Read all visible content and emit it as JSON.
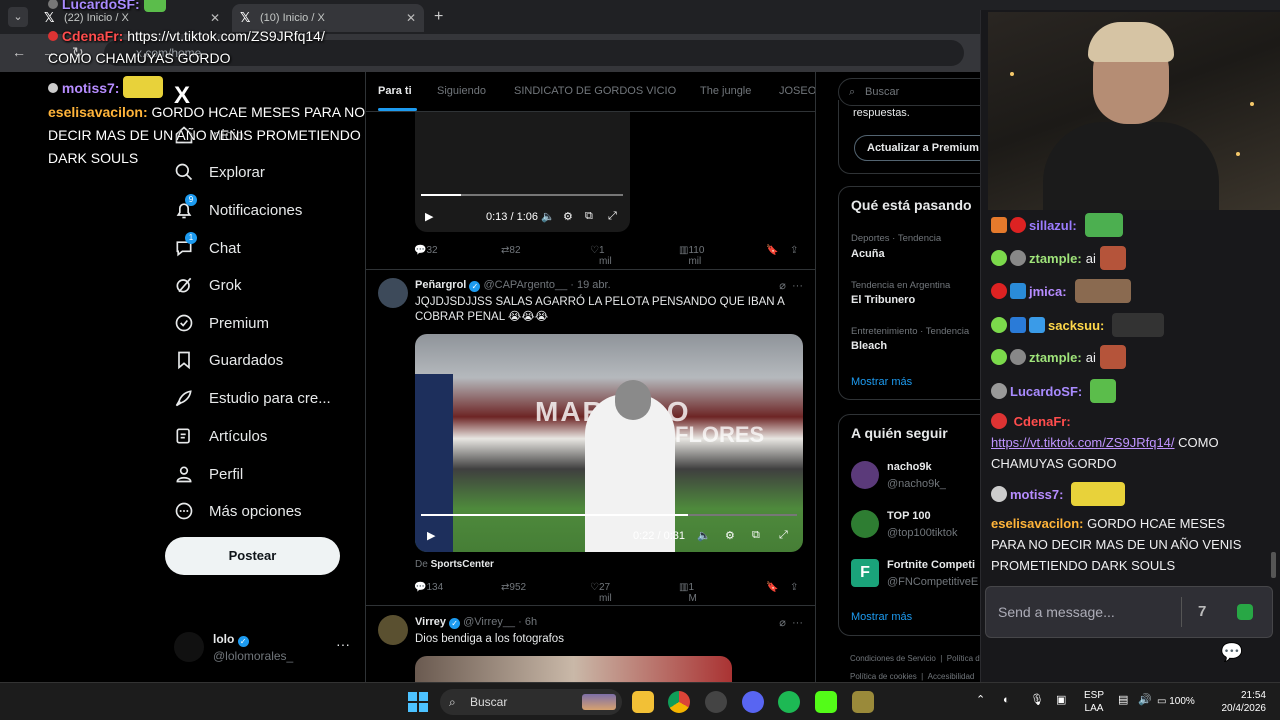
{
  "browser": {
    "tabs": [
      {
        "title": "(22) Inicio / X",
        "close": "✕"
      },
      {
        "title": "(10) Inicio / X",
        "close": "✕"
      }
    ],
    "new_tab": "+",
    "url": "x.com/home"
  },
  "x_nav": {
    "logo": "X",
    "items": [
      {
        "label": "Inicio",
        "icon": "home-icon"
      },
      {
        "label": "Explorar",
        "icon": "search-icon"
      },
      {
        "label": "Notificaciones",
        "icon": "bell-icon",
        "badge": "9"
      },
      {
        "label": "Chat",
        "icon": "chat-icon",
        "badge": "1"
      },
      {
        "label": "Grok",
        "icon": "grok-icon"
      },
      {
        "label": "Premium",
        "icon": "premium-icon"
      },
      {
        "label": "Guardados",
        "icon": "bookmark-icon"
      },
      {
        "label": "Estudio para cre...",
        "icon": "rocket-icon"
      },
      {
        "label": "Artículos",
        "icon": "article-icon"
      },
      {
        "label": "Perfil",
        "icon": "person-icon"
      },
      {
        "label": "Más opciones",
        "icon": "more-icon"
      }
    ],
    "post_button": "Postear",
    "account": {
      "name": "lolo",
      "handle": "@lolomorales_",
      "more": "···"
    }
  },
  "feed": {
    "tabs": [
      "Para ti",
      "Siguiendo",
      "SINDICATO DE GORDOS VICIO",
      "The jungle",
      "JOSEO"
    ],
    "video1": {
      "time": "0:13 / 1:06",
      "progress": 0.2
    },
    "post1_stats": {
      "replies": "32",
      "reposts": "82",
      "likes": "1 mil",
      "views": "110 mil"
    },
    "post2": {
      "name": "Peñargrol",
      "handle": "@CAPArgento__",
      "time": "· 19 abr.",
      "text": "JQJDJSDJJSS SALAS AGARRÓ LA PELOTA PENSANDO QUE IBAN A COBRAR PENAL 😭😭😭",
      "video_time": "0:22 / 0:31",
      "video_progress": 0.71,
      "video_overlay": "MARCELO",
      "video_overlay2": "FLORES",
      "source_prefix": "De",
      "source": "SportsCenter",
      "stats": {
        "replies": "134",
        "reposts": "952",
        "likes": "27 mil",
        "views": "1 M"
      }
    },
    "post3": {
      "name": "Virrey",
      "handle": "@Virrey__",
      "time": "· 6h",
      "text": "Dios bendiga a los fotografos"
    }
  },
  "right": {
    "search_placeholder": "Buscar",
    "premium_text": "respuestas.",
    "premium_button": "Actualizar a Premium",
    "trends_title": "Qué está pasando",
    "trends": [
      {
        "category": "Deportes · Tendencia",
        "name": "Acuña"
      },
      {
        "category": "Tendencia en Argentina",
        "name": "El Tribunero"
      },
      {
        "category": "Entretenimiento · Tendencia",
        "name": "Bleach"
      }
    ],
    "show_more": "Mostrar más",
    "follow_title": "A quién seguir",
    "follow": [
      {
        "name": "nacho9k",
        "handle": "@nacho9k_"
      },
      {
        "name": "TOP 100",
        "handle": "@top100tiktok"
      },
      {
        "name": "Fortnite Competi",
        "handle": "@FNCompetitiveE"
      }
    ],
    "follow_show_more": "Mostrar más",
    "footer": [
      "Condiciones de Servicio",
      "Política de Privacidad",
      "Política de cookies",
      "Accesibilidad"
    ]
  },
  "overlay_chat": [
    {
      "user": "LucardoSF:",
      "text": ""
    },
    {
      "user": "CdenaFr:",
      "text": "https://vt.tiktok.com/ZS9JRfq14/"
    },
    {
      "user": "",
      "text": "COMO CHAMUYAS GORDO"
    },
    {
      "user": "motiss7:",
      "text": ""
    },
    {
      "user": "eselisavacilon:",
      "text": "GORDO HCAE MESES PARA NO"
    },
    {
      "user": "",
      "text": "DECIR MAS DE UN AÑO VENIS PROMETIENDO"
    },
    {
      "user": "",
      "text": "DARK SOULS"
    }
  ],
  "twitch_chat": {
    "messages": [
      {
        "user": "sillazul:",
        "text": "",
        "color": "#9b7cff"
      },
      {
        "user": "ztample:",
        "text": "ai",
        "color": "#9fe37a"
      },
      {
        "user": "jmica:",
        "text": "",
        "color": "#b68cff"
      },
      {
        "user": "sacksuu:",
        "text": "",
        "color": "#ffd84a"
      },
      {
        "user": "ztample:",
        "text": "ai",
        "color": "#9fe37a"
      },
      {
        "user": "LucardoSF:",
        "text": "",
        "color": "#a98bff"
      },
      {
        "user": "CdenaFr:",
        "text": "",
        "color": "#ff4d4d"
      },
      {
        "user": "motiss7:",
        "text": "",
        "color": "#b68cff"
      },
      {
        "user": "eselisavacilon:",
        "text": "GORDO HCAE MESES PARA NO DECIR MAS DE UN AÑO VENIS PROMETIENDO DARK SOULS",
        "color": "#ffb43a"
      }
    ],
    "link": "https://vt.tiktok.com/ZS9JRfq14/",
    "link_rest": "COMO CHAMUYAS GORDO",
    "input_placeholder": "Send a message..."
  },
  "taskbar": {
    "search": "Buscar",
    "language": "ESP",
    "language2": "LAA",
    "battery": "100%",
    "time": "21:54",
    "date": "20/4/2026"
  }
}
